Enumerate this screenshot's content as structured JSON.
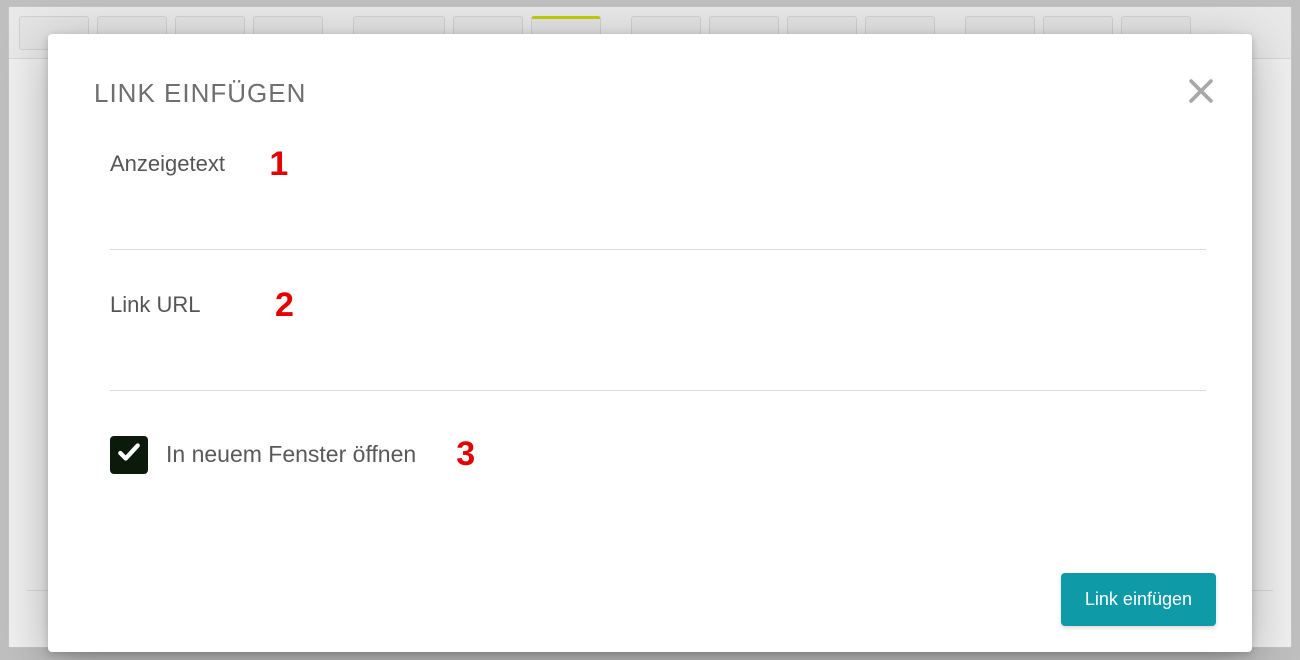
{
  "modal": {
    "title": "LINK EINFÜGEN",
    "fields": {
      "display_text_label": "Anzeigetext",
      "display_text_value": "",
      "url_label": "Link URL",
      "url_value": ""
    },
    "checkbox": {
      "label": "In neuem Fenster öffnen",
      "checked": true
    },
    "submit_label": "Link einfügen"
  },
  "annotations": {
    "a1": "1",
    "a2": "2",
    "a3": "3"
  }
}
